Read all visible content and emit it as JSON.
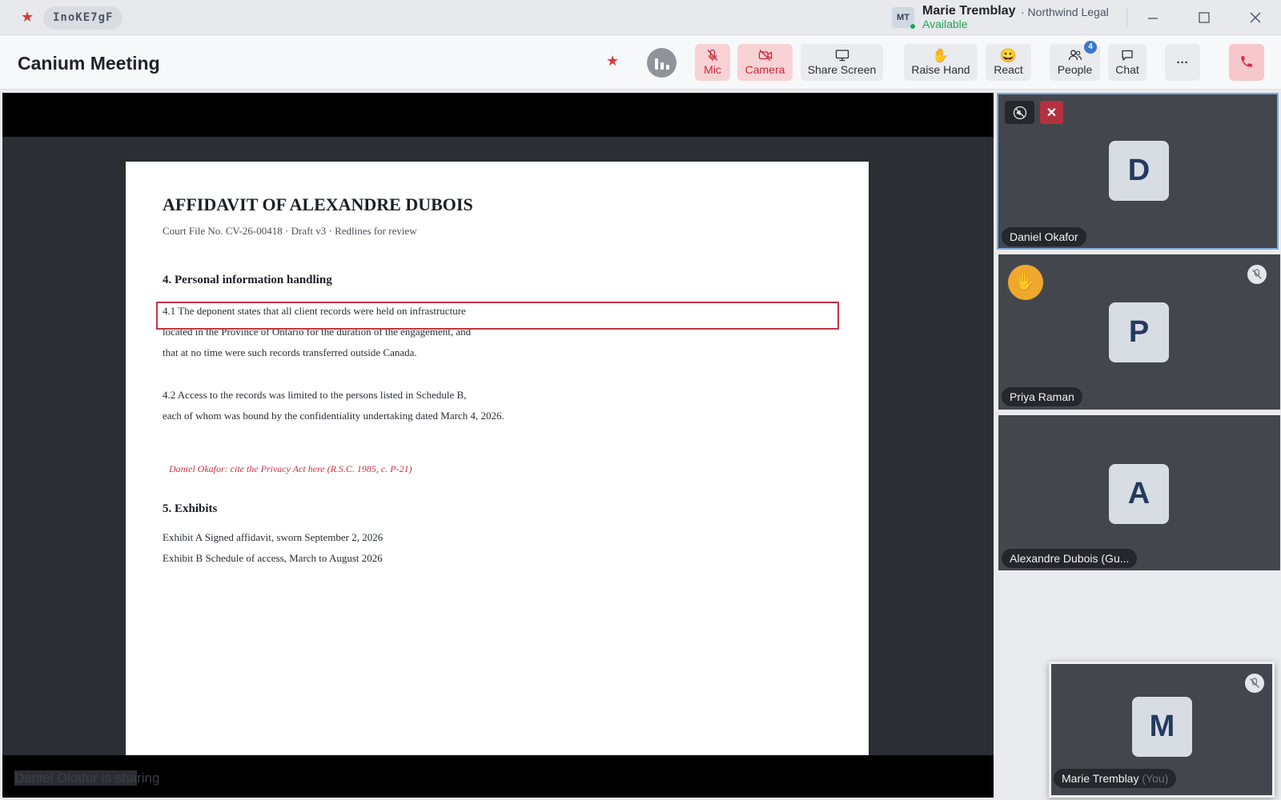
{
  "titlebar": {
    "room_code": "InoKE7gF",
    "user": {
      "initials": "MT",
      "name": "Marie Tremblay",
      "org": "· Northwind Legal",
      "status": "Available"
    }
  },
  "toolbar": {
    "title": "Canium Meeting",
    "buttons": {
      "mic": "Mic",
      "camera": "Camera",
      "share_screen": "Share Screen",
      "raise_hand": "Raise Hand",
      "react": "React",
      "people": "People",
      "people_count": "4",
      "chat": "Chat",
      "more": "···"
    }
  },
  "stage": {
    "sharing_name": "Daniel Okafor is sha",
    "sharing_rest": "ring"
  },
  "document": {
    "title": "AFFIDAVIT OF ALEXANDRE DUBOIS",
    "meta": "Court File No. CV-26-00418  ·  Draft v3  ·  Redlines for review",
    "section4_heading": "4.  Personal information handling",
    "para41": [
      "4.1  The deponent states that all client records were held on infrastructure",
      "located in the Province of Ontario for the duration of the engagement, and",
      "that at no time were such records transferred outside Canada."
    ],
    "para42": [
      "4.2  Access to the records was limited to the persons listed in Schedule B,",
      "each of whom was bound by the confidentiality undertaking dated March 4, 2026."
    ],
    "comment": "Daniel Okafor: cite the Privacy Act here (R.S.C. 1985, c. P-21)",
    "section5_heading": "5.  Exhibits",
    "exhibits": [
      "Exhibit A   Signed affidavit, sworn September 2, 2026",
      "Exhibit B   Schedule of access, March to August 2026"
    ]
  },
  "participants": [
    {
      "initial": "D",
      "name": "Daniel Okafor"
    },
    {
      "initial": "P",
      "name": "Priya Raman"
    },
    {
      "initial": "A",
      "name": "Alexandre Dubois (Gu..."
    }
  ],
  "self": {
    "initial": "M",
    "name": "Marie Tremblay",
    "you": "(You)"
  },
  "icons": {
    "title_star": "star-icon",
    "mute": "speaker-muted-icon",
    "hand": "✋",
    "react": "😀"
  },
  "colors": {
    "accent_red": "#c8283a",
    "available_green": "#22a357",
    "active_border": "#7fa8dc",
    "hand_yellow": "#f0a82c"
  }
}
